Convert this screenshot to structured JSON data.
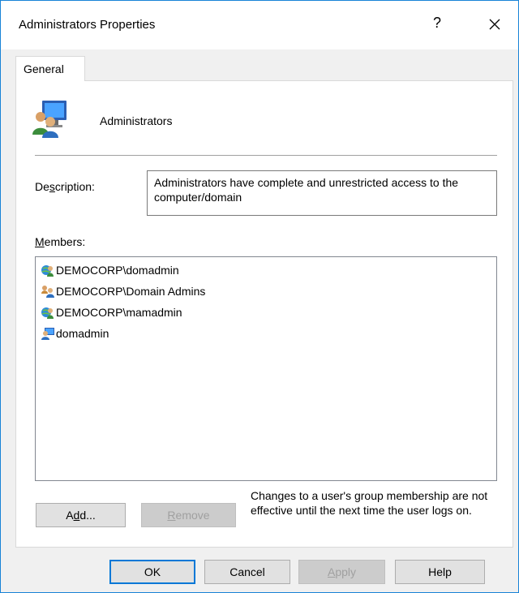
{
  "window": {
    "title": "Administrators Properties",
    "help_label": "?",
    "close_icon": "close-icon"
  },
  "tabs": [
    {
      "label": "General",
      "selected": true
    }
  ],
  "general": {
    "group_icon": "group-icon",
    "group_name": "Administrators",
    "description_label": "Description:",
    "description_value": "Administrators have complete and unrestricted access to the computer/domain",
    "members_label": "Members:",
    "members": [
      {
        "name": "DEMOCORP\\domadmin",
        "icon": "domain-user-icon"
      },
      {
        "name": "DEMOCORP\\Domain Admins",
        "icon": "group-icon"
      },
      {
        "name": "DEMOCORP\\mamadmin",
        "icon": "domain-user-icon"
      },
      {
        "name": "domadmin",
        "icon": "local-user-icon"
      }
    ],
    "add_label": "Add...",
    "remove_label": "Remove",
    "note": "Changes to a user's group membership are not effective until the next time the user logs on."
  },
  "footer": {
    "ok_label": "OK",
    "cancel_label": "Cancel",
    "apply_label": "Apply",
    "help_label": "Help"
  },
  "colors": {
    "accent": "#0078d7",
    "window_border": "#1883d7",
    "dialog_bg": "#f0f0f0",
    "disabled_text": "#a0a0a0"
  }
}
